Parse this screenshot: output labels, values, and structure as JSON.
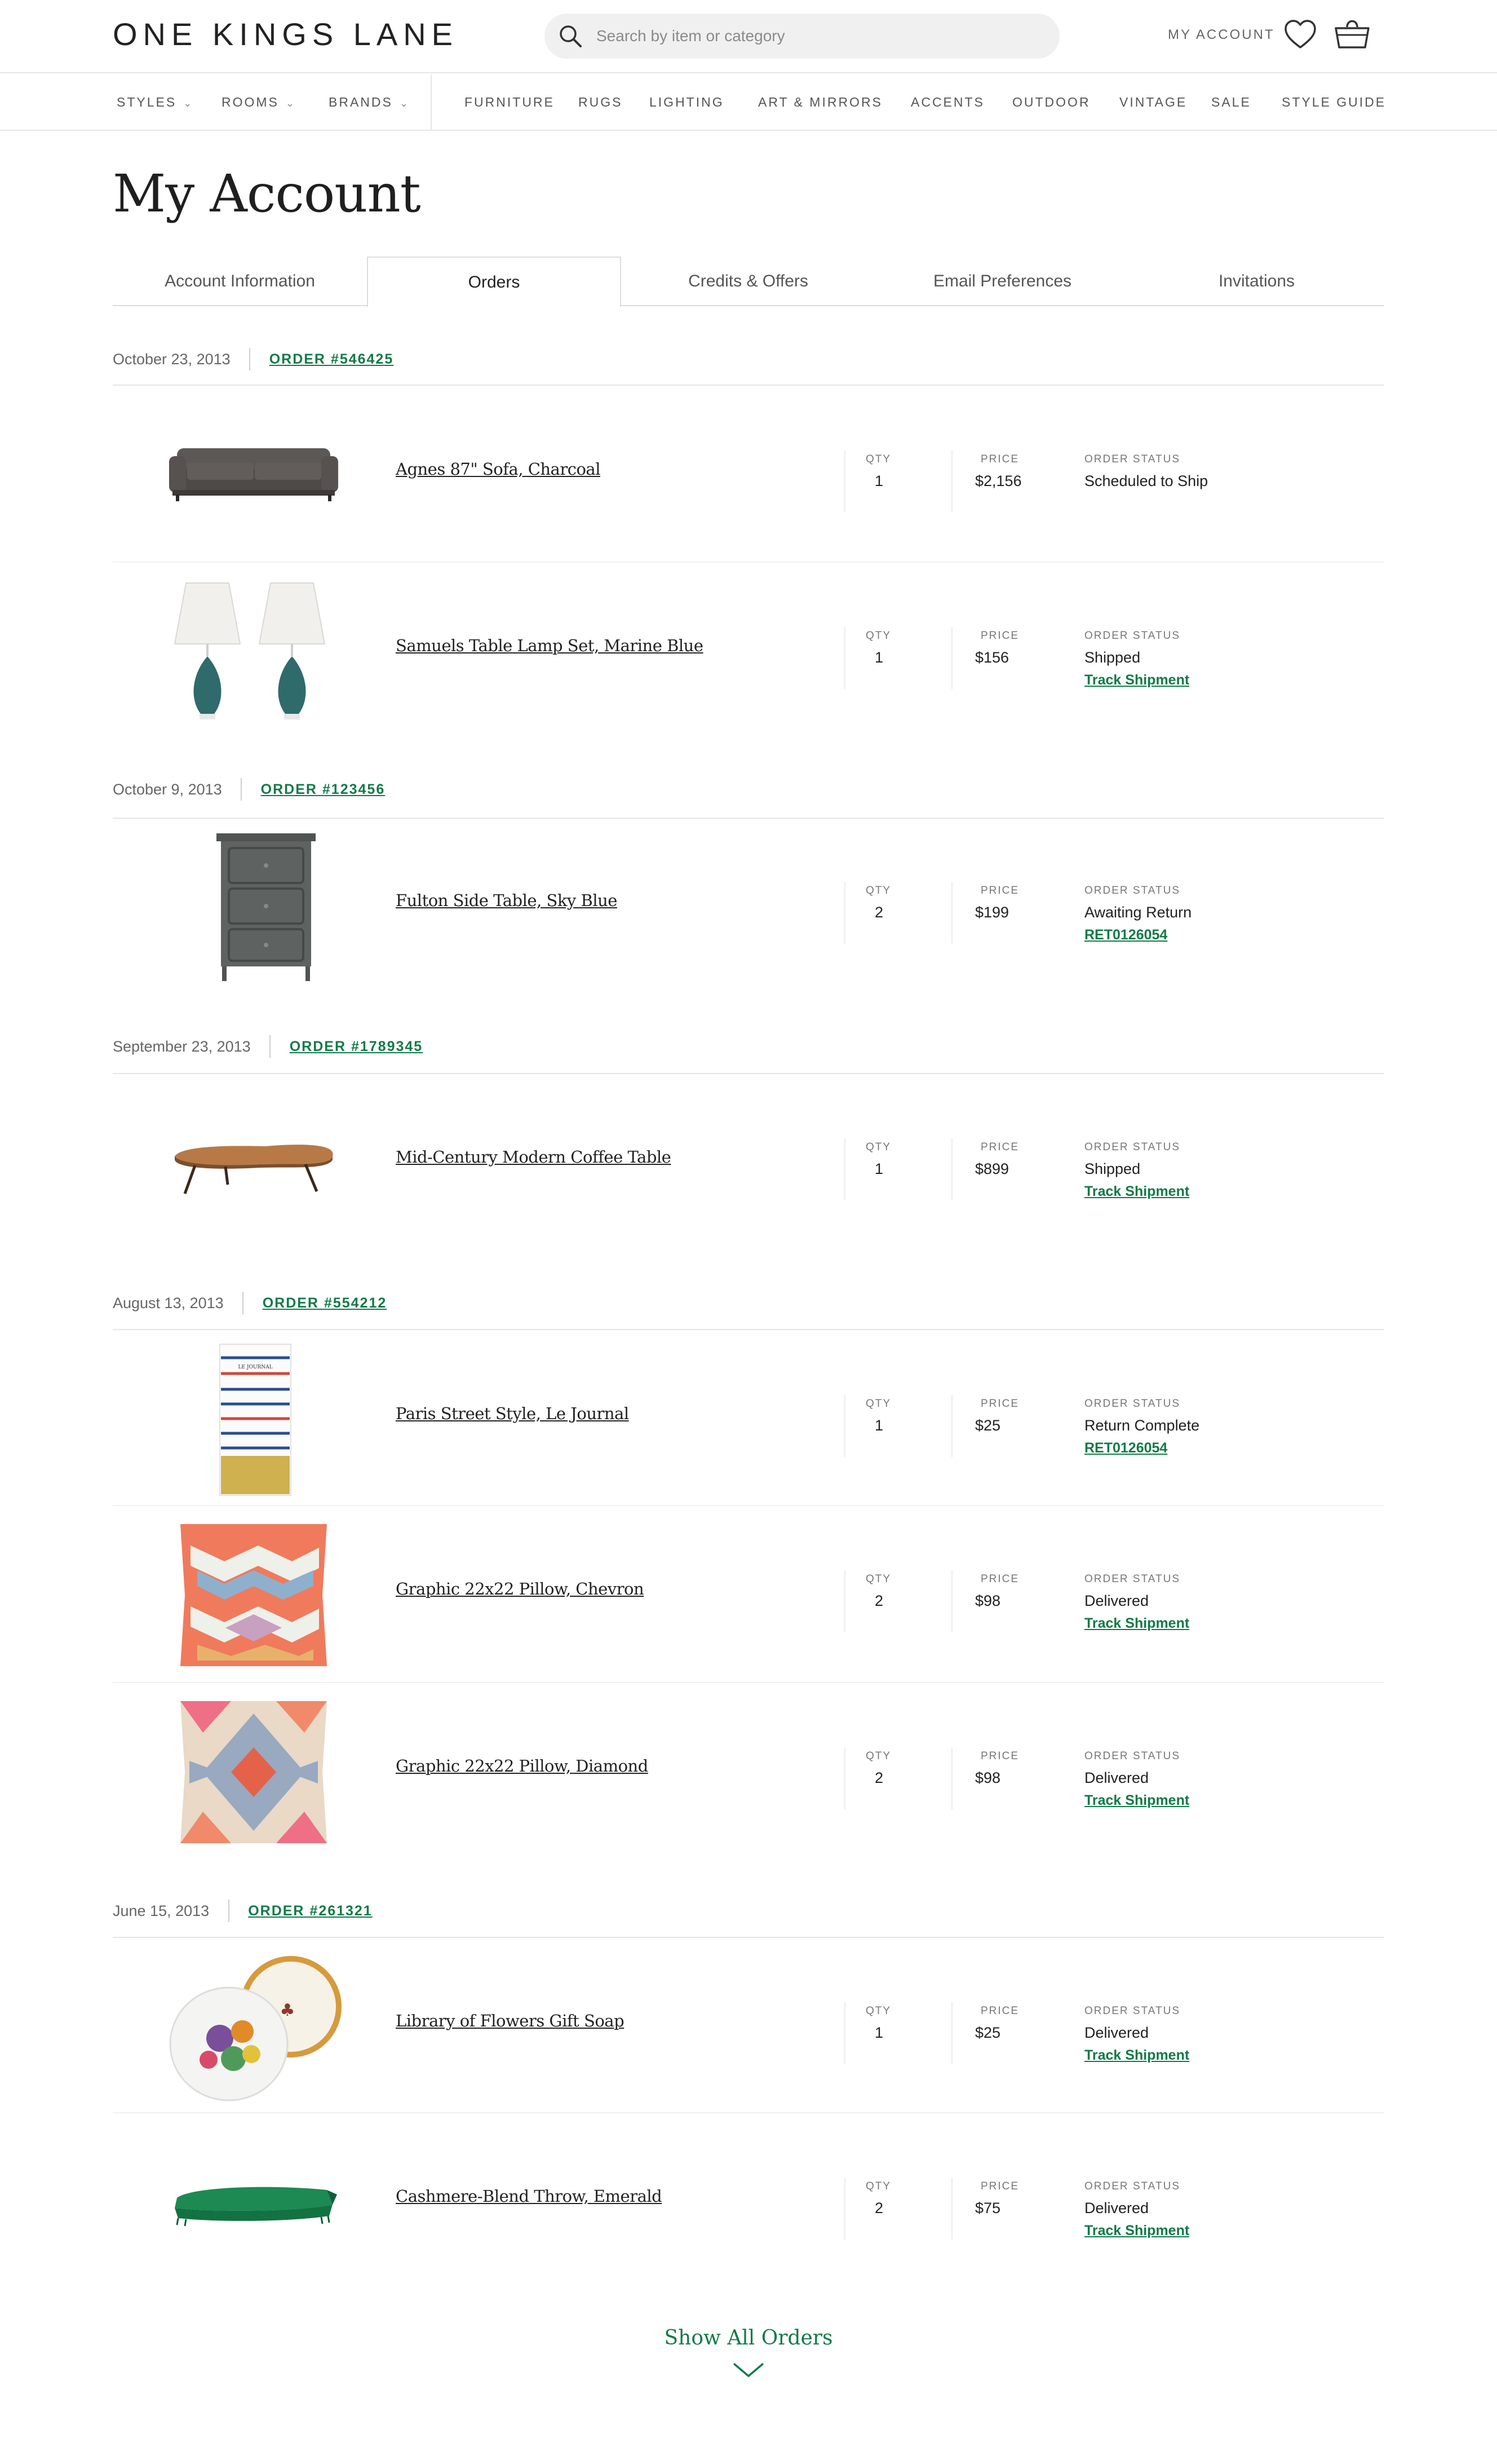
{
  "header": {
    "logo": "ONE KINGS LANE",
    "search_placeholder": "Search by item or category",
    "account_label": "MY ACCOUNT"
  },
  "nav": {
    "dropdowns": [
      "STYLES",
      "ROOMS",
      "BRANDS"
    ],
    "links": [
      "FURNITURE",
      "RUGS",
      "LIGHTING",
      "ART & MIRRORS",
      "ACCENTS",
      "OUTDOOR",
      "VINTAGE",
      "SALE",
      "STYLE GUIDE"
    ]
  },
  "page": {
    "title": "My Account"
  },
  "tabs": [
    {
      "label": "Account Information",
      "active": false
    },
    {
      "label": "Orders",
      "active": true
    },
    {
      "label": "Credits & Offers",
      "active": false
    },
    {
      "label": "Email Preferences",
      "active": false
    },
    {
      "label": "Invitations",
      "active": false
    }
  ],
  "labels": {
    "qty": "QTY",
    "price": "PRICE",
    "status": "ORDER STATUS"
  },
  "orders": [
    {
      "date": "October 23, 2013",
      "number": "ORDER #546425",
      "items": [
        {
          "name": "Agnes 87\" Sofa, Charcoal",
          "qty": "1",
          "price": "$2,156",
          "status": "Scheduled to Ship",
          "link": "",
          "thumb": "sofa"
        },
        {
          "name": "Samuels Table Lamp Set, Marine Blue",
          "qty": "1",
          "price": "$156",
          "status": "Shipped",
          "link": "Track Shipment",
          "thumb": "lamps"
        }
      ]
    },
    {
      "date": "October 9, 2013",
      "number": "ORDER #123456",
      "items": [
        {
          "name": "Fulton Side Table, Sky Blue",
          "qty": "2",
          "price": "$199",
          "status": "Awaiting Return",
          "link": "RET0126054",
          "thumb": "side-table"
        }
      ]
    },
    {
      "date": "September 23, 2013",
      "number": "ORDER #1789345",
      "items": [
        {
          "name": "Mid-Century Modern Coffee Table",
          "qty": "1",
          "price": "$899",
          "status": "Shipped",
          "link": "Track Shipment",
          "thumb": "coffee-table"
        }
      ]
    },
    {
      "date": "August 13, 2013",
      "number": "ORDER #554212",
      "items": [
        {
          "name": "Paris Street Style, Le Journal",
          "qty": "1",
          "price": "$25",
          "status": "Return Complete",
          "link": "RET0126054",
          "thumb": "journal",
          "thumb_text": "LE JOURNAL"
        },
        {
          "name": "Graphic 22x22 Pillow, Chevron",
          "qty": "2",
          "price": "$98",
          "status": "Delivered",
          "link": "Track Shipment",
          "thumb": "pillow-chevron"
        },
        {
          "name": "Graphic 22x22 Pillow, Diamond",
          "qty": "2",
          "price": "$98",
          "status": "Delivered",
          "link": "Track Shipment",
          "thumb": "pillow-diamond"
        }
      ]
    },
    {
      "date": "June 15, 2013",
      "number": "ORDER #261321",
      "items": [
        {
          "name": "Library of Flowers Gift Soap",
          "qty": "1",
          "price": "$25",
          "status": "Delivered",
          "link": "Track Shipment",
          "thumb": "soap"
        },
        {
          "name": "Cashmere-Blend Throw, Emerald",
          "qty": "2",
          "price": "$75",
          "status": "Delivered",
          "link": "Track Shipment",
          "thumb": "throw"
        }
      ]
    }
  ],
  "footer": {
    "show_all": "Show All Orders"
  },
  "colors": {
    "accent_green": "#127a48",
    "divider": "#e5e5e5",
    "search_bg": "#f0f0f0"
  }
}
